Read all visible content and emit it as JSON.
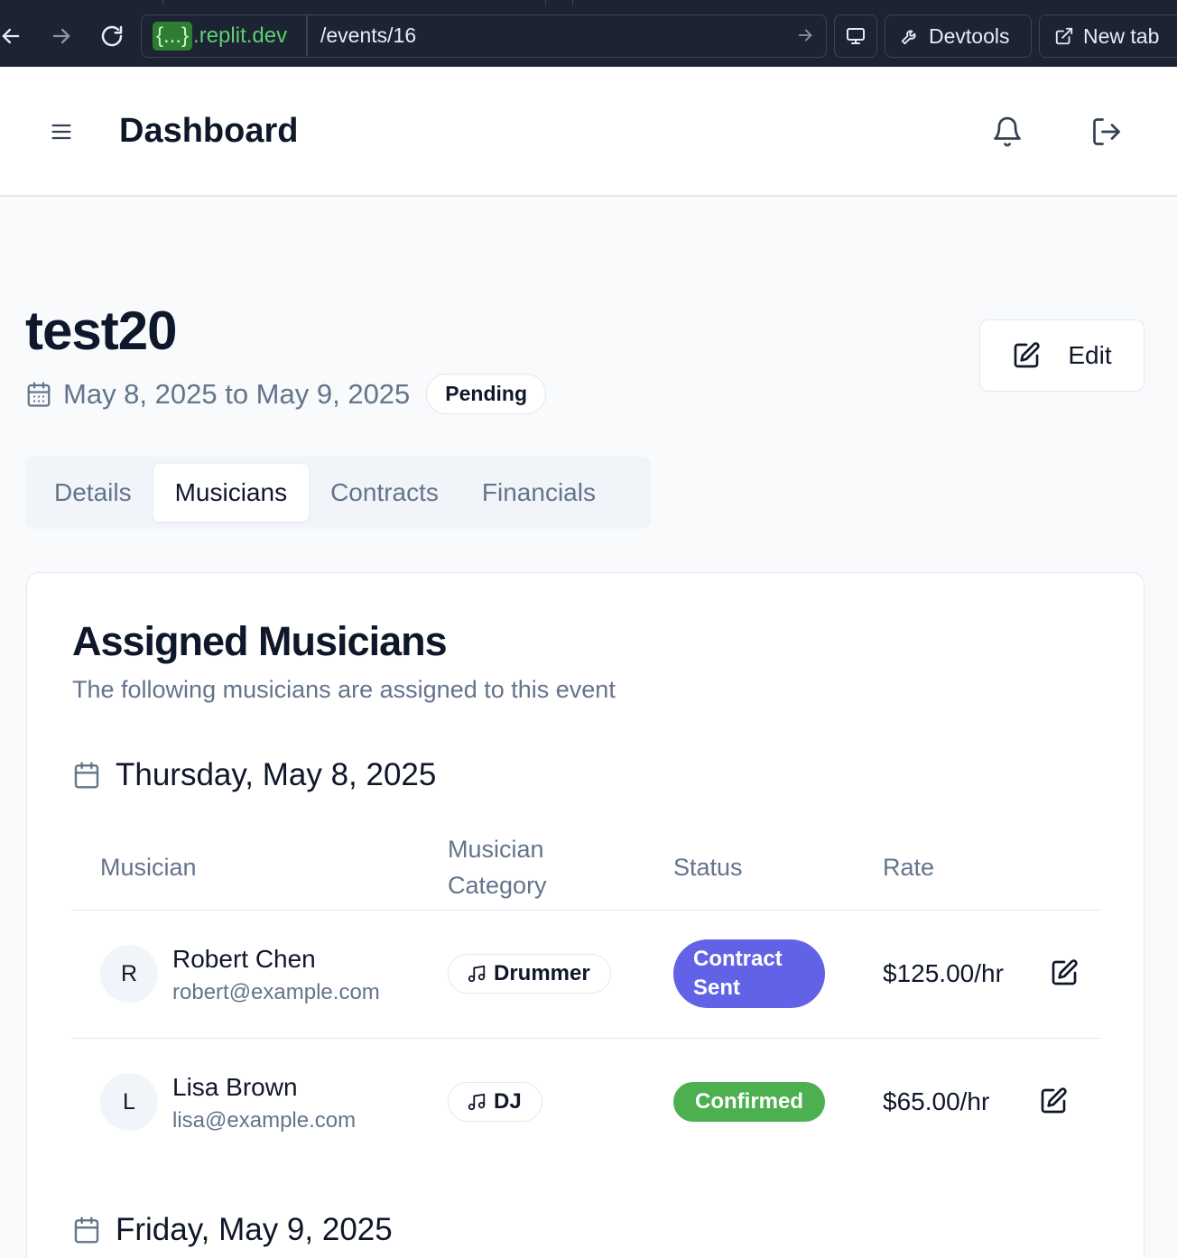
{
  "browser": {
    "url_host_brace": "{...}",
    "url_host": ".replit.dev",
    "url_path": "/events/16",
    "devtools_label": "Devtools",
    "newtab_label": "New tab"
  },
  "header": {
    "title": "Dashboard"
  },
  "event": {
    "title": "test20",
    "dates": "May 8, 2025 to May 9, 2025",
    "status": "Pending",
    "edit_label": "Edit"
  },
  "tabs": [
    {
      "label": "Details",
      "active": false
    },
    {
      "label": "Musicians",
      "active": true
    },
    {
      "label": "Contracts",
      "active": false
    },
    {
      "label": "Financials",
      "active": false
    }
  ],
  "card": {
    "title": "Assigned Musicians",
    "subtitle": "The following musicians are assigned to this event"
  },
  "table": {
    "headers": [
      "Musician",
      "Musician Category",
      "Status",
      "Rate"
    ]
  },
  "days": [
    {
      "label": "Thursday, May 8, 2025",
      "rows": [
        {
          "initial": "R",
          "name": "Robert Chen",
          "email": "robert@example.com",
          "category": "Drummer",
          "status": "Contract Sent",
          "rate": "$125.00/hr"
        },
        {
          "initial": "L",
          "name": "Lisa Brown",
          "email": "lisa@example.com",
          "category": "DJ",
          "status": "Confirmed",
          "rate": "$65.00/hr"
        }
      ]
    },
    {
      "label": "Friday, May 9, 2025",
      "rows": []
    }
  ],
  "colors": {
    "status_contract_sent": "#6262e6",
    "status_confirmed": "#4caf50",
    "chrome_bg": "#1c2333",
    "host_green": "#5fcf6f"
  },
  "icons": [
    "back-arrow-icon",
    "forward-arrow-icon",
    "reload-icon",
    "go-arrow-icon",
    "monitor-icon",
    "wrench-icon",
    "external-link-icon",
    "hamburger-menu-icon",
    "bell-icon",
    "logout-icon",
    "calendar-icon",
    "edit-icon",
    "music-note-icon"
  ]
}
